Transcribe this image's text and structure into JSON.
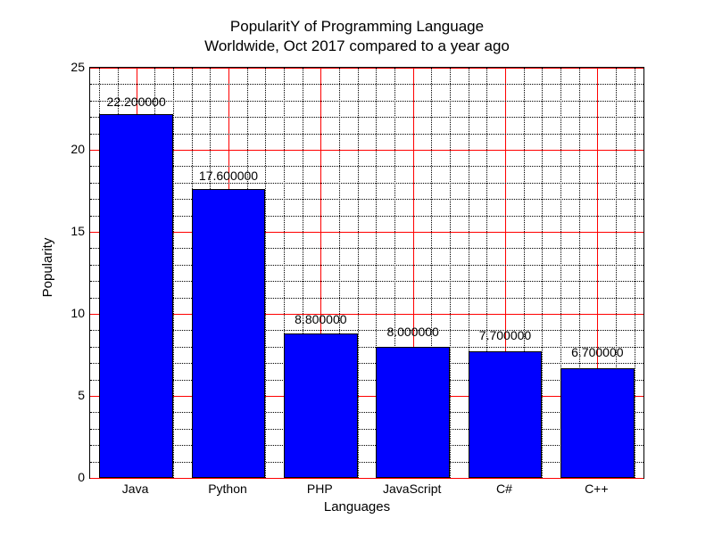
{
  "chart_data": {
    "type": "bar",
    "title_line1": "PopularitY of Programming Language",
    "title_line2": "Worldwide, Oct 2017 compared to a year ago",
    "xlabel": "Languages",
    "ylabel": "Popularity",
    "categories": [
      "Java",
      "Python",
      "PHP",
      "JavaScript",
      "C#",
      "C++"
    ],
    "values": [
      22.2,
      17.6,
      8.8,
      8.0,
      7.7,
      6.7
    ],
    "value_labels": [
      "22.200000",
      "17.600000",
      "8.800000",
      "8.000000",
      "7.700000",
      "6.700000"
    ],
    "yticks": [
      0,
      5,
      10,
      15,
      20,
      25
    ],
    "ylim": [
      0,
      25
    ]
  }
}
